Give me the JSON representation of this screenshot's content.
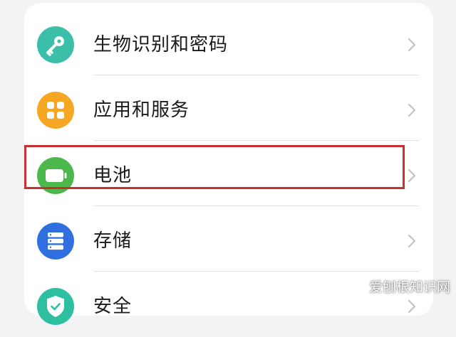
{
  "settings_list": {
    "items": [
      {
        "label": "生物识别和密码",
        "icon": "key-icon",
        "color": "#3cbfa8"
      },
      {
        "label": "应用和服务",
        "icon": "apps-grid-icon",
        "color": "#f5a623"
      },
      {
        "label": "电池",
        "icon": "battery-icon",
        "color": "#4cb84c"
      },
      {
        "label": "存储",
        "icon": "storage-icon",
        "color": "#2f6fe0"
      },
      {
        "label": "安全",
        "icon": "shield-icon",
        "color": "#2ebfa0"
      }
    ]
  },
  "highlight": {
    "color": "#c8312f",
    "target": "电池"
  },
  "watermark": {
    "text": "爱刨根知识网"
  }
}
